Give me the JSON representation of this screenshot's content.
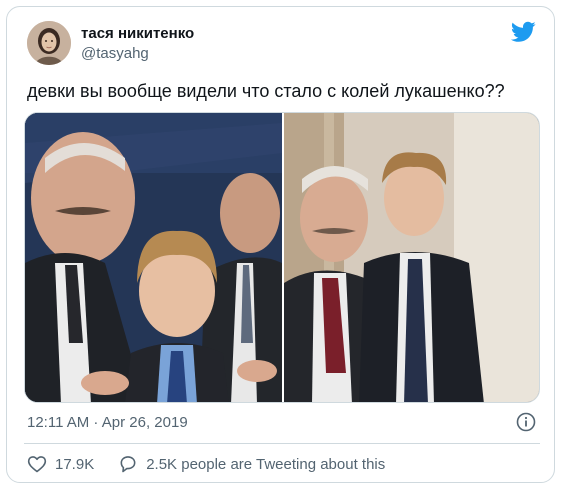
{
  "author": {
    "display_name": "тася никитенко",
    "handle": "@tasyahg",
    "avatar_icon": "profile-photo"
  },
  "brand": {
    "icon": "twitter-bird-icon",
    "color": "#1d9bf0"
  },
  "tweet": {
    "text": "девки вы вообще видели что стало с колей лукашенко??",
    "media_icon": "photo-collage"
  },
  "meta": {
    "timestamp": "12:11 AM · Apr 26, 2019",
    "info_icon": "info-icon"
  },
  "actions": {
    "likes": "17.9K",
    "conversation": "2.5K people are Tweeting about this",
    "like_icon": "heart-icon",
    "reply_icon": "speech-bubble-icon"
  },
  "colors": {
    "text_primary": "#0f1419",
    "text_secondary": "#536471",
    "border": "#cfd9de"
  }
}
